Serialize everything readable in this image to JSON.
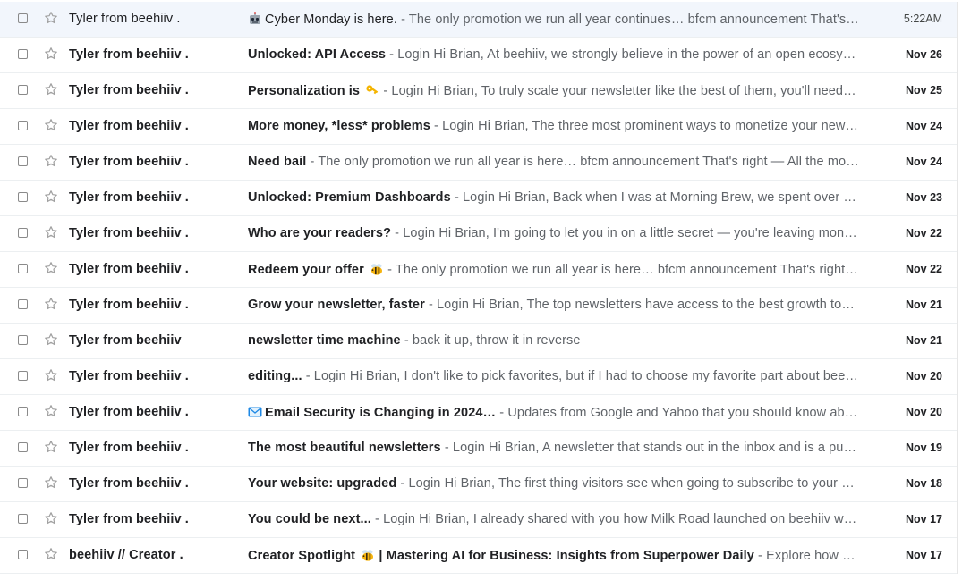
{
  "emails": [
    {
      "sender": "Tyler from beehiiv .",
      "subject": "Cyber Monday is here.",
      "subject_icon": "robot-icon",
      "subject_icon_position": "before",
      "snippet": "The only promotion we run all year continues…   bfcm announcement That's right — All the most…",
      "date": "5:22AM",
      "read": true
    },
    {
      "sender": "Tyler from beehiiv .",
      "subject": "Unlocked: API Access",
      "snippet": "Login Hi Brian, At beehiiv, we strongly believe in the power of an open ecosystem…",
      "date": "Nov 26",
      "read": false
    },
    {
      "sender": "Tyler from beehiiv .",
      "subject": "Personalization is",
      "subject_icon": "key-icon",
      "subject_icon_position": "after",
      "snippet": "Login Hi Brian, To truly scale your newsletter like the best of them, you'll need to …",
      "date": "Nov 25",
      "read": false
    },
    {
      "sender": "Tyler from beehiiv .",
      "subject": "More money, *less* problems",
      "snippet": "Login Hi Brian, The three most prominent ways to monetize your newsletter…",
      "date": "Nov 24",
      "read": false
    },
    {
      "sender": "Tyler from beehiiv .",
      "subject": "Need bail",
      "snippet": "The only promotion we run all year is here…   bfcm announcement That's right — All the most…",
      "date": "Nov 24",
      "read": false
    },
    {
      "sender": "Tyler from beehiiv .",
      "subject": "Unlocked: Premium Dashboards",
      "snippet": "Login Hi Brian, Back when I was at Morning Brew, we spent over a year…",
      "date": "Nov 23",
      "read": false
    },
    {
      "sender": "Tyler from beehiiv .",
      "subject": "Who are your readers?",
      "snippet": "Login Hi Brian, I'm going to let you in on a little secret — you're leaving money a…",
      "date": "Nov 22",
      "read": false
    },
    {
      "sender": "Tyler from beehiiv .",
      "subject": "Redeem your offer",
      "subject_icon": "bee-icon",
      "subject_icon_position": "after",
      "snippet": "The only promotion we run all year is here…   bfcm announcement That's right …",
      "date": "Nov 22",
      "read": false
    },
    {
      "sender": "Tyler from beehiiv .",
      "subject": "Grow your newsletter, faster",
      "snippet": "Login Hi Brian, The top newsletters have access to the best growth tools, …",
      "date": "Nov 21",
      "read": false
    },
    {
      "sender": "Tyler from beehiiv",
      "subject": "newsletter time machine",
      "snippet": "back it up, throw it in reverse",
      "date": "Nov 21",
      "read": false
    },
    {
      "sender": "Tyler from beehiiv .",
      "subject": "editing...",
      "snippet": "Login Hi Brian, I don't like to pick favorites, but if I had to choose my favorite part about beehiiv…",
      "date": "Nov 20",
      "read": false
    },
    {
      "sender": "Tyler from beehiiv .",
      "subject": "Email Security is Changing in 2024…",
      "subject_icon": "envelope-icon",
      "subject_icon_position": "before",
      "snippet": "Updates from Google and Yahoo that you should know about …",
      "date": "Nov 20",
      "read": false
    },
    {
      "sender": "Tyler from beehiiv .",
      "subject": "The most beautiful newsletters",
      "snippet": "Login Hi Brian, A newsletter that stands out in the inbox and is a pure j…",
      "date": "Nov 19",
      "read": false
    },
    {
      "sender": "Tyler from beehiiv .",
      "subject": "Your website: upgraded",
      "snippet": "Login Hi Brian, The first thing visitors see when going to subscribe to your new…",
      "date": "Nov 18",
      "read": false
    },
    {
      "sender": "Tyler from beehiiv .",
      "subject": "You could be next...",
      "snippet": "Login Hi Brian, I already shared with you how Milk Road launched on beehiiv with n…",
      "date": "Nov 17",
      "read": false
    },
    {
      "sender": "beehiiv // Creator .",
      "subject": "Creator Spotlight",
      "subject_icon": "bee-icon",
      "subject_icon_position": "after",
      "subject_suffix": " | Mastering AI for Business: Insights from Superpower Daily",
      "snippet": "Explore how Saee…",
      "date": "Nov 17",
      "read": false
    }
  ],
  "separator": " - ",
  "colors": {
    "read_row_bg": "#f2f6fc",
    "unread_row_bg": "#ffffff",
    "text_primary": "#202124",
    "text_secondary": "#5f6368",
    "divider": "#eceff1"
  }
}
